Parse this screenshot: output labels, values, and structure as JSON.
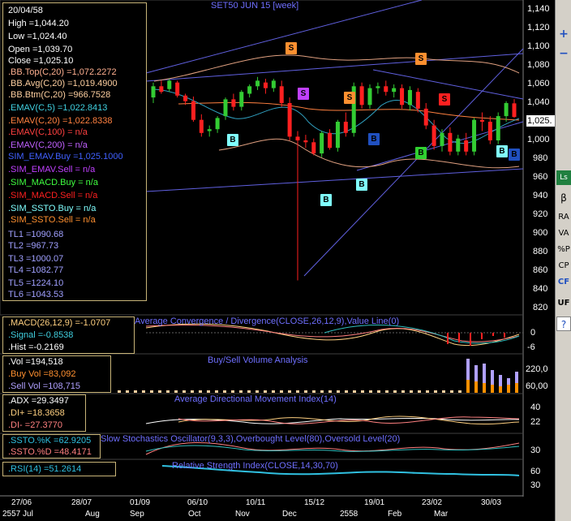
{
  "chart_title": "SET50 JUN 15   [week]",
  "info": {
    "date": "20/04/58",
    "high": "High  =1,044.20",
    "low": "Low  =1,024.40",
    "open": "Open  =1,039.70",
    "close": "Close  =1,025.10",
    "bb_top": ".BB.Top(C,20)  =1,072.2272",
    "bb_avg": ".BB.Avg(C,20)  =1,019.4900",
    "bb_btm": ".BB.Btm(C,20)  =966.7528",
    "emav5": ".EMAV(C,5)  =1,022.8413",
    "emav20": ".EMAV(C,20)  =1,022.8338",
    "emav100": ".EMAV(C,100)  = n/a",
    "emav200": ".EMAV(C,200)  = n/a",
    "sim_emav_buy": "SIM_EMAV.Buy  =1,025.1000",
    "sim_emav_sell": ".SIM_EMAV.Sell  = n/a",
    "sim_macd_buy": ".SIM_MACD.Buy  = n/a",
    "sim_macd_sell": ".SIM_MACD.Sell  = n/a",
    "sim_ssto_buy": ".SIM_SSTO.Buy  = n/a",
    "sim_ssto_sell": ".SIM_SSTO.Sell  = n/a",
    "tl1": "TL1 =1090.68",
    "tl2": "TL2 =967.73",
    "tl3": "TL3 =1000.07",
    "tl4": "TL4 =1082.77",
    "tl5": "TL5 =1224.10",
    "tl6": "TL6 =1043.53"
  },
  "price_axis": {
    "ticks": [
      "1,140",
      "1,120",
      "1,100",
      "1,080",
      "1,060",
      "1,040",
      "1,020",
      "1,000",
      "980",
      "960",
      "940",
      "920",
      "900",
      "880",
      "860",
      "840",
      "820"
    ],
    "current_price": "1,025."
  },
  "macd": {
    "title": "Average Convergence / Divergence(CLOSE,26,12,9),Value Line(0)",
    "line": ".MACD(26,12,9)  =-1.0707",
    "signal": ".Signal  =-0.8538",
    "hist": ".Hist  =-0.2169",
    "ticks": [
      "0",
      "-6"
    ]
  },
  "volume": {
    "title": "Buy/Sell Volume Analysis",
    "vol": ".Vol  =194,518",
    "buy": ".Buy Vol  =83,092",
    "sell": ".Sell Vol  =108,715",
    "ticks": [
      "220,0",
      "60,00"
    ]
  },
  "adx": {
    "title": "Average Directional Movement Index(14)",
    "adx": ".ADX  =29.3497",
    "di_plus": ".DI+  =18.3658",
    "di_minus": ".DI-  =27.3770",
    "ticks": [
      "40",
      "22"
    ]
  },
  "ssto": {
    "title": "Slow Stochastics Oscillator(9,3,3),Overbought Level(80),Oversold Level(20)",
    "k": ".SSTO.%K  =62.9205",
    "d": ".SSTO.%D  =48.4171",
    "ticks": [
      "30"
    ]
  },
  "rsi": {
    "title": "Relative Strength Index(CLOSE,14,30,70)",
    "value": ".RSI(14)  =51.2614",
    "ticks": [
      "60",
      "30"
    ]
  },
  "x_axis": {
    "dates": [
      "27/06",
      "28/07",
      "01/09",
      "06/10",
      "10/11",
      "15/12",
      "19/01",
      "23/02",
      "30/03"
    ],
    "months": [
      "2557 Jul",
      "Aug",
      "Sep",
      "Oct",
      "Nov",
      "Dec",
      "2558",
      "Feb",
      "Mar"
    ]
  },
  "signals": {
    "buy": "B",
    "sell": "S"
  },
  "toolbar": {
    "plus": "+",
    "minus": "−",
    "ls": "Ls",
    "beta": "β",
    "ra": "RA",
    "va": "VA",
    "pct": "%P",
    "cp": "CP",
    "cf": "CF",
    "uf": "UF",
    "help": "?"
  },
  "colors": {
    "bull": "#33cc33",
    "bear": "#ff2020",
    "title": "#6f6fff",
    "panel_border": "#c8b478"
  },
  "chart_data": {
    "type": "candlestick",
    "title": "SET50 JUN 15   [week]",
    "ylim": [
      820,
      1140
    ],
    "candles": [
      {
        "o": 1046,
        "h": 1062,
        "l": 1040,
        "c": 1058
      },
      {
        "o": 1058,
        "h": 1064,
        "l": 1050,
        "c": 1052
      },
      {
        "o": 1055,
        "h": 1066,
        "l": 1052,
        "c": 1064
      },
      {
        "o": 1062,
        "h": 1064,
        "l": 1046,
        "c": 1048
      },
      {
        "o": 1048,
        "h": 1050,
        "l": 1038,
        "c": 1042
      },
      {
        "o": 1042,
        "h": 1047,
        "l": 1020,
        "c": 1022
      },
      {
        "o": 1022,
        "h": 1028,
        "l": 1004,
        "c": 1008
      },
      {
        "o": 1010,
        "h": 1016,
        "l": 1004,
        "c": 1012
      },
      {
        "o": 1012,
        "h": 1026,
        "l": 1008,
        "c": 1024
      },
      {
        "o": 1026,
        "h": 1046,
        "l": 1022,
        "c": 1044
      },
      {
        "o": 1044,
        "h": 1050,
        "l": 1032,
        "c": 1036
      },
      {
        "o": 1036,
        "h": 1054,
        "l": 1032,
        "c": 1052
      },
      {
        "o": 1050,
        "h": 1060,
        "l": 1046,
        "c": 1058
      },
      {
        "o": 1058,
        "h": 1068,
        "l": 1054,
        "c": 1064
      },
      {
        "o": 1062,
        "h": 1066,
        "l": 1050,
        "c": 1056
      },
      {
        "o": 1056,
        "h": 1066,
        "l": 1052,
        "c": 1064
      },
      {
        "o": 1058,
        "h": 1064,
        "l": 1036,
        "c": 1040
      },
      {
        "o": 1040,
        "h": 1046,
        "l": 1000,
        "c": 1004
      },
      {
        "o": 1004,
        "h": 1010,
        "l": 850,
        "c": 1000
      },
      {
        "o": 1000,
        "h": 1006,
        "l": 992,
        "c": 998
      },
      {
        "o": 998,
        "h": 1002,
        "l": 984,
        "c": 986
      },
      {
        "o": 986,
        "h": 1010,
        "l": 982,
        "c": 1008
      },
      {
        "o": 1008,
        "h": 1012,
        "l": 990,
        "c": 992
      },
      {
        "o": 992,
        "h": 1022,
        "l": 988,
        "c": 1020
      },
      {
        "o": 1020,
        "h": 1030,
        "l": 1004,
        "c": 1008
      },
      {
        "o": 1008,
        "h": 1062,
        "l": 1004,
        "c": 1058
      },
      {
        "o": 1058,
        "h": 1062,
        "l": 1034,
        "c": 1038
      },
      {
        "o": 1038,
        "h": 1060,
        "l": 1034,
        "c": 1056
      },
      {
        "o": 1056,
        "h": 1062,
        "l": 1050,
        "c": 1058
      },
      {
        "o": 1058,
        "h": 1064,
        "l": 1048,
        "c": 1052
      },
      {
        "o": 1052,
        "h": 1060,
        "l": 1046,
        "c": 1056
      },
      {
        "o": 1056,
        "h": 1060,
        "l": 1034,
        "c": 1038
      },
      {
        "o": 1038,
        "h": 1058,
        "l": 1032,
        "c": 1054
      },
      {
        "o": 1052,
        "h": 1056,
        "l": 1030,
        "c": 1034
      },
      {
        "o": 1034,
        "h": 1040,
        "l": 1012,
        "c": 1016
      },
      {
        "o": 1016,
        "h": 1022,
        "l": 990,
        "c": 994
      },
      {
        "o": 994,
        "h": 1012,
        "l": 988,
        "c": 1008
      },
      {
        "o": 1008,
        "h": 1014,
        "l": 984,
        "c": 988
      },
      {
        "o": 988,
        "h": 1006,
        "l": 984,
        "c": 1002
      },
      {
        "o": 1000,
        "h": 1008,
        "l": 984,
        "c": 988
      },
      {
        "o": 988,
        "h": 1024,
        "l": 984,
        "c": 1022
      },
      {
        "o": 1022,
        "h": 1030,
        "l": 1010,
        "c": 1020
      },
      {
        "o": 1020,
        "h": 1026,
        "l": 996,
        "c": 1000
      },
      {
        "o": 1000,
        "h": 1030,
        "l": 996,
        "c": 1026
      },
      {
        "o": 1026,
        "h": 1042,
        "l": 1020,
        "c": 1040
      },
      {
        "o": 1039.7,
        "h": 1044.2,
        "l": 1024.4,
        "c": 1025.1
      }
    ]
  }
}
